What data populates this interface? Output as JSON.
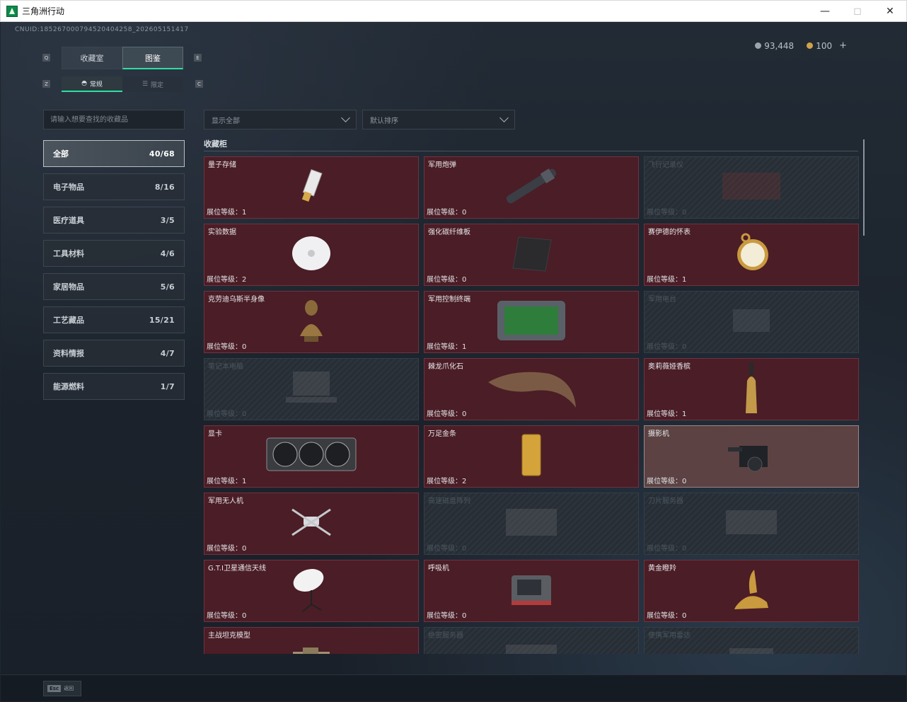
{
  "window": {
    "title": "三角洲行动"
  },
  "uid": "CNUID:185267000794520404258_202605151417",
  "currency": {
    "silver": "93,448",
    "gold": "100",
    "add": "+"
  },
  "tabs_main": [
    {
      "label": "收藏室"
    },
    {
      "label": "图鉴"
    }
  ],
  "tabs_sub": [
    {
      "label": "常规"
    },
    {
      "label": "限定"
    }
  ],
  "keys": {
    "q": "Q",
    "e": "E",
    "z": "Z",
    "c": "C"
  },
  "search": {
    "placeholder": "请输入想要查找的收藏品"
  },
  "filters": {
    "display": "显示全部",
    "sort": "默认排序"
  },
  "categories": [
    {
      "label": "全部",
      "count": "40/68"
    },
    {
      "label": "电子物品",
      "count": "8/16"
    },
    {
      "label": "医疗道具",
      "count": "3/5"
    },
    {
      "label": "工具材料",
      "count": "4/6"
    },
    {
      "label": "家居物品",
      "count": "5/6"
    },
    {
      "label": "工艺藏品",
      "count": "15/21"
    },
    {
      "label": "资料情报",
      "count": "4/7"
    },
    {
      "label": "能源燃料",
      "count": "1/7"
    }
  ],
  "section": {
    "title": "收藏柜"
  },
  "level_prefix": "展位等级：",
  "items": [
    {
      "name": "量子存储",
      "level": "展位等级：1",
      "state": "owned",
      "icon": "usb-icon"
    },
    {
      "name": "军用炮弹",
      "level": "展位等级：0",
      "state": "owned",
      "icon": "shell-icon"
    },
    {
      "name": "飞行记录仪",
      "level": "展位等级：0",
      "state": "locked",
      "icon": "recorder-icon"
    },
    {
      "name": "实验数据",
      "level": "展位等级：2",
      "state": "owned",
      "icon": "disc-icon"
    },
    {
      "name": "强化碳纤维板",
      "level": "展位等级：0",
      "state": "owned",
      "icon": "carbon-plate-icon"
    },
    {
      "name": "赛伊德的怀表",
      "level": "展位等级：1",
      "state": "owned",
      "icon": "pocket-watch-icon"
    },
    {
      "name": "克劳迪乌斯半身像",
      "level": "展位等级：0",
      "state": "owned",
      "icon": "bust-icon"
    },
    {
      "name": "军用控制终端",
      "level": "展位等级：1",
      "state": "owned",
      "icon": "terminal-icon"
    },
    {
      "name": "军用电台",
      "level": "展位等级：0",
      "state": "locked",
      "icon": "radio-icon"
    },
    {
      "name": "笔记本电脑",
      "level": "展位等级：0",
      "state": "locked",
      "icon": "laptop-icon"
    },
    {
      "name": "棘龙爪化石",
      "level": "展位等级：0",
      "state": "owned",
      "icon": "claw-icon"
    },
    {
      "name": "奥莉薇娅香槟",
      "level": "展位等级：1",
      "state": "owned",
      "icon": "bottle-icon"
    },
    {
      "name": "显卡",
      "level": "展位等级：1",
      "state": "owned",
      "icon": "gpu-icon"
    },
    {
      "name": "万足金条",
      "level": "展位等级：2",
      "state": "owned",
      "icon": "gold-bar-icon"
    },
    {
      "name": "摄影机",
      "level": "展位等级：0",
      "state": "highlight",
      "icon": "camera-icon"
    },
    {
      "name": "军用无人机",
      "level": "展位等级：0",
      "state": "owned",
      "icon": "drone-icon"
    },
    {
      "name": "高速磁盘阵列",
      "level": "展位等级：0",
      "state": "locked",
      "icon": "disk-array-icon"
    },
    {
      "name": "刀片服务器",
      "level": "展位等级：0",
      "state": "locked",
      "icon": "server-icon"
    },
    {
      "name": "G.T.I卫星通信天线",
      "level": "展位等级：0",
      "state": "owned",
      "icon": "satellite-dish-icon"
    },
    {
      "name": "呼吸机",
      "level": "展位等级：0",
      "state": "owned",
      "icon": "ventilator-icon"
    },
    {
      "name": "黄金瞪羚",
      "level": "展位等级：0",
      "state": "owned",
      "icon": "gazelle-icon"
    },
    {
      "name": "主战坦克模型",
      "level": "",
      "state": "owned",
      "icon": "tank-icon"
    },
    {
      "name": "绝密服务器",
      "level": "",
      "state": "locked",
      "icon": "server-icon"
    },
    {
      "name": "便携军用雷达",
      "level": "",
      "state": "locked",
      "icon": "radar-icon"
    }
  ],
  "bottom": {
    "esc_key": "Esc",
    "esc_label": "返回"
  },
  "colors": {
    "accent": "#2fe0a0",
    "owned_card": "#4b1d26",
    "locked_card": "#262d35"
  }
}
